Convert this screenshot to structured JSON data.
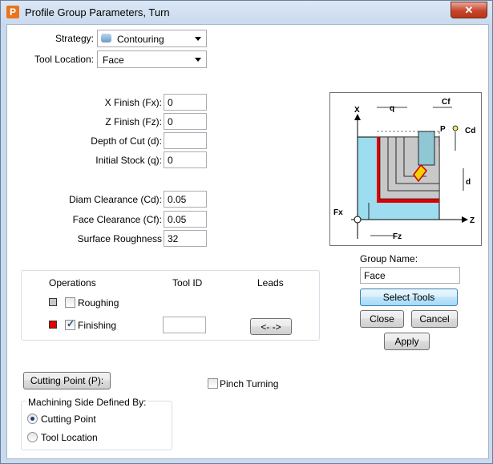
{
  "window": {
    "title": "Profile Group Parameters, Turn",
    "close_glyph": "✕",
    "app_icon_letter": "P"
  },
  "strategy": {
    "label": "Strategy:",
    "value": "Contouring"
  },
  "tool_location": {
    "label": "Tool Location:",
    "value": "Face"
  },
  "fields": {
    "x_finish": {
      "label": "X Finish (Fx):",
      "value": "0"
    },
    "z_finish": {
      "label": "Z Finish (Fz):",
      "value": "0"
    },
    "depth_of_cut": {
      "label": "Depth of Cut (d):",
      "value": ""
    },
    "initial_stock": {
      "label": "Initial Stock (q):",
      "value": "0"
    },
    "diam_clearance": {
      "label": "Diam Clearance (Cd):",
      "value": "0.05"
    },
    "face_clearance": {
      "label": "Face Clearance (Cf):",
      "value": "0.05"
    },
    "surface_roughness": {
      "label": "Surface Roughness",
      "value": "32"
    }
  },
  "operations": {
    "header_operations": "Operations",
    "header_tool_id": "Tool ID",
    "header_leads": "Leads",
    "roughing": {
      "label": "Roughing",
      "checked": false,
      "color": "#c8c8c8"
    },
    "finishing": {
      "label": "Finishing",
      "checked": true,
      "color": "#e00000",
      "tool_id": ""
    },
    "leads_button": "<- ->"
  },
  "diagram": {
    "labels": {
      "x_axis": "X",
      "z_axis": "Z",
      "q": "q",
      "cf": "Cf",
      "cd": "Cd",
      "p": "P",
      "d": "d",
      "fx": "Fx",
      "fz": "Fz"
    },
    "colors": {
      "stock": "#9edcf0",
      "finish": "#e00000",
      "rough": "#c8c8c8",
      "tool": "#f2d300"
    }
  },
  "group_name": {
    "label": "Group Name:",
    "value": "Face"
  },
  "buttons": {
    "select_tools": "Select Tools",
    "close": "Close",
    "cancel": "Cancel",
    "apply": "Apply",
    "cutting_point": "Cutting Point (P):"
  },
  "pinch_turning": {
    "label": "Pinch Turning",
    "checked": false
  },
  "machining_side": {
    "legend": "Machining Side Defined By:",
    "options": [
      {
        "label": "Cutting Point",
        "selected": true
      },
      {
        "label": "Tool Location",
        "selected": false
      }
    ]
  }
}
